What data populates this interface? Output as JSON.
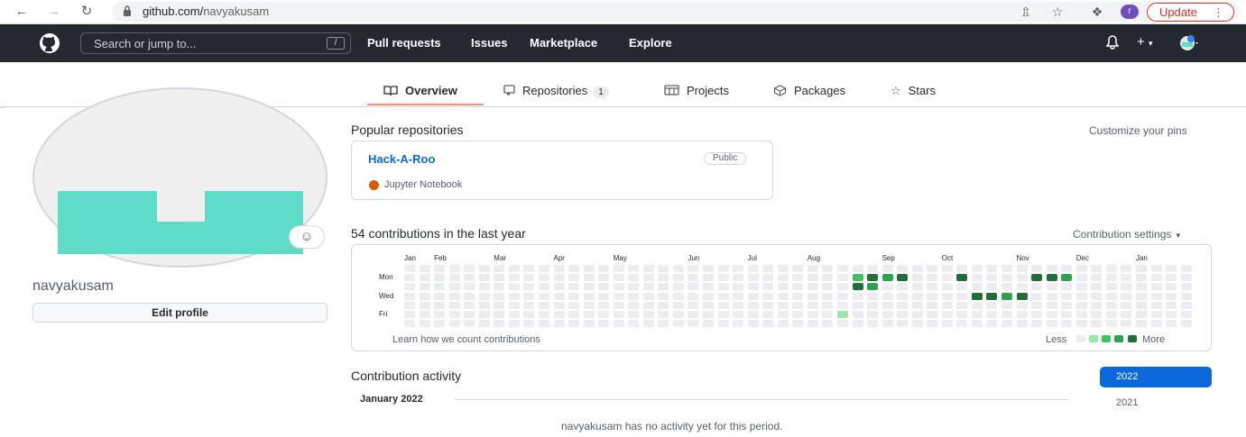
{
  "browser": {
    "url_host": "github.com/",
    "url_path": "navyakusam",
    "profile_initial": "r",
    "update_label": "Update"
  },
  "header": {
    "search_placeholder": "Search or jump to...",
    "search_shortcut": "/",
    "nav": [
      "Pull requests",
      "Issues",
      "Marketplace",
      "Explore"
    ],
    "plus_label": "+"
  },
  "tabs": [
    {
      "label": "Overview",
      "icon": "book-icon",
      "active": true
    },
    {
      "label": "Repositories",
      "icon": "repo-icon",
      "count": "1"
    },
    {
      "label": "Projects",
      "icon": "project-icon"
    },
    {
      "label": "Packages",
      "icon": "package-icon"
    },
    {
      "label": "Stars",
      "icon": "star-icon"
    }
  ],
  "profile": {
    "username": "navyakusam",
    "edit_label": "Edit profile",
    "identicon_color": "#5fdbc9"
  },
  "popular": {
    "title": "Popular repositories",
    "customize_label": "Customize your pins",
    "repo": {
      "name": "Hack-A-Roo",
      "visibility": "Public",
      "language": "Jupyter Notebook",
      "language_color": "#da5b0b"
    }
  },
  "contributions": {
    "title": "54 contributions in the last year",
    "settings_label": "Contribution settings",
    "months": [
      "Jan",
      "Feb",
      "Mar",
      "Apr",
      "May",
      "Jun",
      "Jul",
      "Aug",
      "Sep",
      "Oct",
      "Nov",
      "Dec",
      "Jan"
    ],
    "days": [
      "Mon",
      "Wed",
      "Fri"
    ],
    "learn_label": "Learn how we count contributions",
    "legend_less": "Less",
    "legend_more": "More",
    "levels": [
      "#ebedf0",
      "#9be9a8",
      "#40c463",
      "#30a14e",
      "#216e39"
    ],
    "active_cells": [
      {
        "week": 30,
        "day": 1,
        "level": 2
      },
      {
        "week": 31,
        "day": 1,
        "level": 4
      },
      {
        "week": 32,
        "day": 1,
        "level": 3
      },
      {
        "week": 33,
        "day": 1,
        "level": 4
      },
      {
        "week": 37,
        "day": 1,
        "level": 4
      },
      {
        "week": 42,
        "day": 1,
        "level": 4
      },
      {
        "week": 43,
        "day": 1,
        "level": 4
      },
      {
        "week": 44,
        "day": 1,
        "level": 3
      },
      {
        "week": 30,
        "day": 2,
        "level": 4
      },
      {
        "week": 31,
        "day": 2,
        "level": 3
      },
      {
        "week": 38,
        "day": 3,
        "level": 4
      },
      {
        "week": 39,
        "day": 3,
        "level": 4
      },
      {
        "week": 40,
        "day": 3,
        "level": 3
      },
      {
        "week": 41,
        "day": 3,
        "level": 4
      },
      {
        "week": 29,
        "day": 5,
        "level": 1
      }
    ]
  },
  "activity": {
    "title": "Contribution activity",
    "years": [
      "2022",
      "2021"
    ],
    "month_heading": "January 2022",
    "empty_message": "navyakusam has no activity yet for this period."
  }
}
